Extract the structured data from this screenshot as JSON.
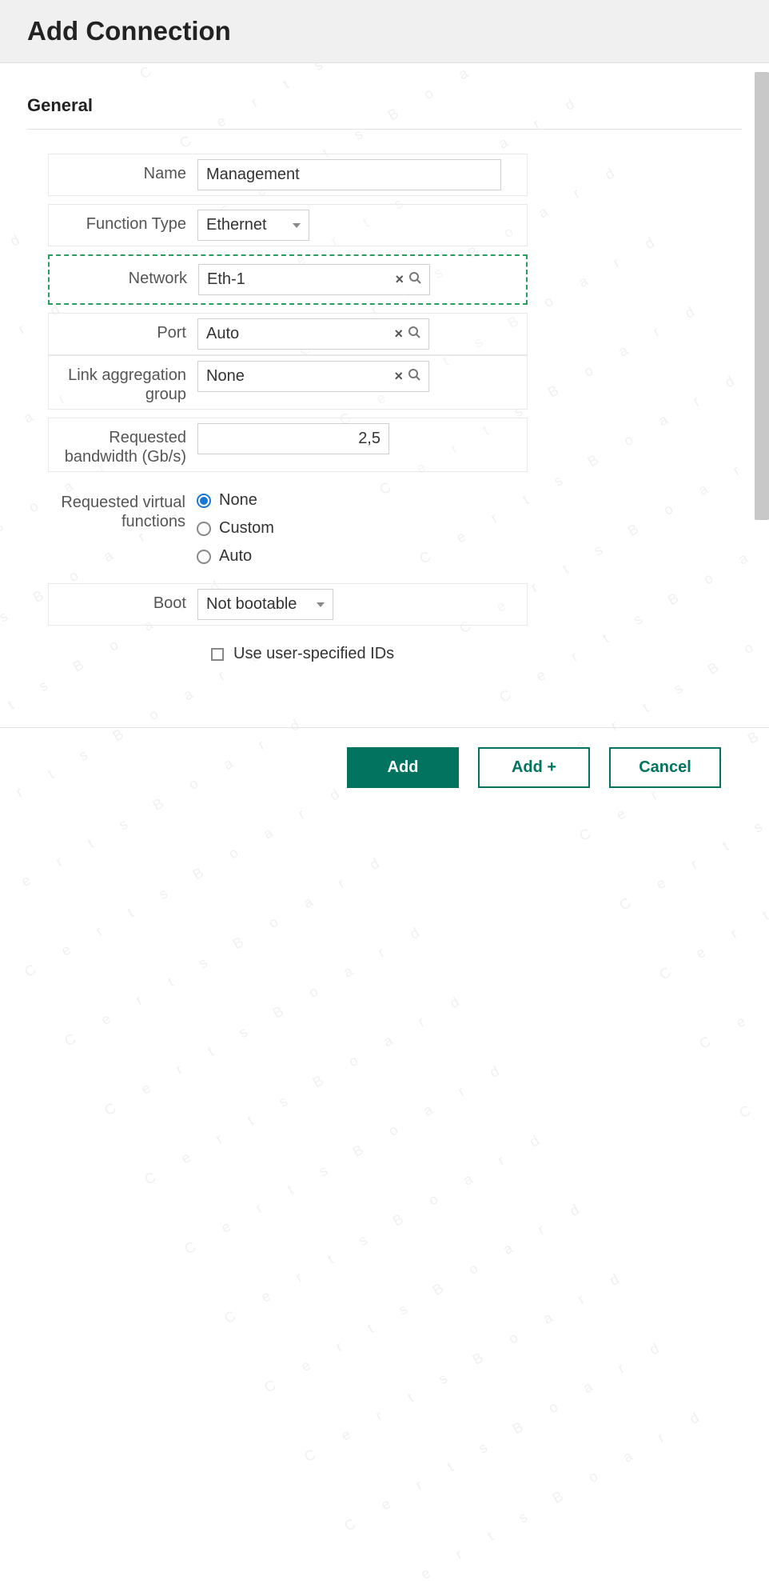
{
  "watermark_text": "CertsBoard",
  "header": {
    "title": "Add Connection"
  },
  "section": {
    "title": "General"
  },
  "fields": {
    "name": {
      "label": "Name",
      "value": "Management"
    },
    "function_type": {
      "label": "Function Type",
      "value": "Ethernet"
    },
    "network": {
      "label": "Network",
      "value": "Eth-1"
    },
    "port": {
      "label": "Port",
      "value": "Auto"
    },
    "lag": {
      "label": "Link aggregation group",
      "value": "None"
    },
    "bandwidth": {
      "label": "Requested bandwidth (Gb/s)",
      "value": "2,5"
    },
    "virtual_functions": {
      "label": "Requested virtual functions",
      "options": {
        "none": "None",
        "custom": "Custom",
        "auto": "Auto"
      },
      "selected": "none"
    },
    "boot": {
      "label": "Boot",
      "value": "Not bootable"
    },
    "user_ids": {
      "label": "Use user-specified IDs",
      "checked": false
    }
  },
  "buttons": {
    "add": "Add",
    "add_plus": "Add +",
    "cancel": "Cancel"
  }
}
